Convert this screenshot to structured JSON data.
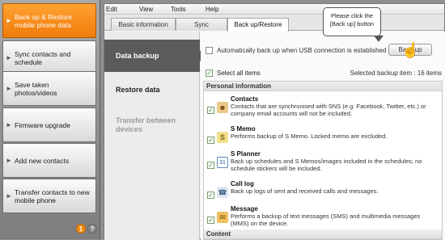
{
  "sidebar": {
    "items": [
      {
        "label": "Back up & Restore mobile phone data",
        "active": true
      },
      {
        "label": "Sync contacts and schedule",
        "active": false
      },
      {
        "label": "Save taken photos/videos",
        "active": false
      },
      {
        "label": "Firmware upgrade",
        "active": false
      },
      {
        "label": "Add new contacts",
        "active": false
      },
      {
        "label": "Transfer contacts to new mobile phone",
        "active": false
      }
    ],
    "badges": [
      "1",
      "?"
    ]
  },
  "menu": [
    "Edit",
    "View",
    "Tools",
    "Help"
  ],
  "tabs": [
    "Basic information",
    "Sync",
    "Back up/Restore"
  ],
  "nav": [
    "Data backup",
    "Restore data",
    "Transfer between devices"
  ],
  "auto_backup_label": "Automatically back up when USB connection is established",
  "backup_button": "Back up",
  "select_all_label": "Select all items",
  "selected_count": "Selected backup item : 16 items",
  "sections": {
    "personal": "Personal information",
    "content": "Content"
  },
  "items": [
    {
      "name": "Contacts",
      "desc": "Contacts that are synchronised with SNS (e.g. Facebook, Twitter, etc.) or company email accounts will not be included.",
      "icon": "contacts-icon"
    },
    {
      "name": "S Memo",
      "desc": "Performs backup of S Memo. Locked memo are excluded.",
      "icon": "s-memo-icon"
    },
    {
      "name": "S Planner",
      "desc": "Back up schedules and S Memos/images included in the schedules; no schedule stickers will be included.",
      "icon": "calendar-icon"
    },
    {
      "name": "Call log",
      "desc": "Back up logs of sent and received calls and messages.",
      "icon": "phone-icon"
    },
    {
      "name": "Message",
      "desc": "Performs a backup of text messages (SMS) and multimedia messages (MMS) on the device.",
      "icon": "envelope-icon"
    }
  ],
  "tooltip": "Please click the [Back up] button",
  "colors": {
    "accent": "#f07b0a",
    "active_nav": "#5b5b5b"
  }
}
